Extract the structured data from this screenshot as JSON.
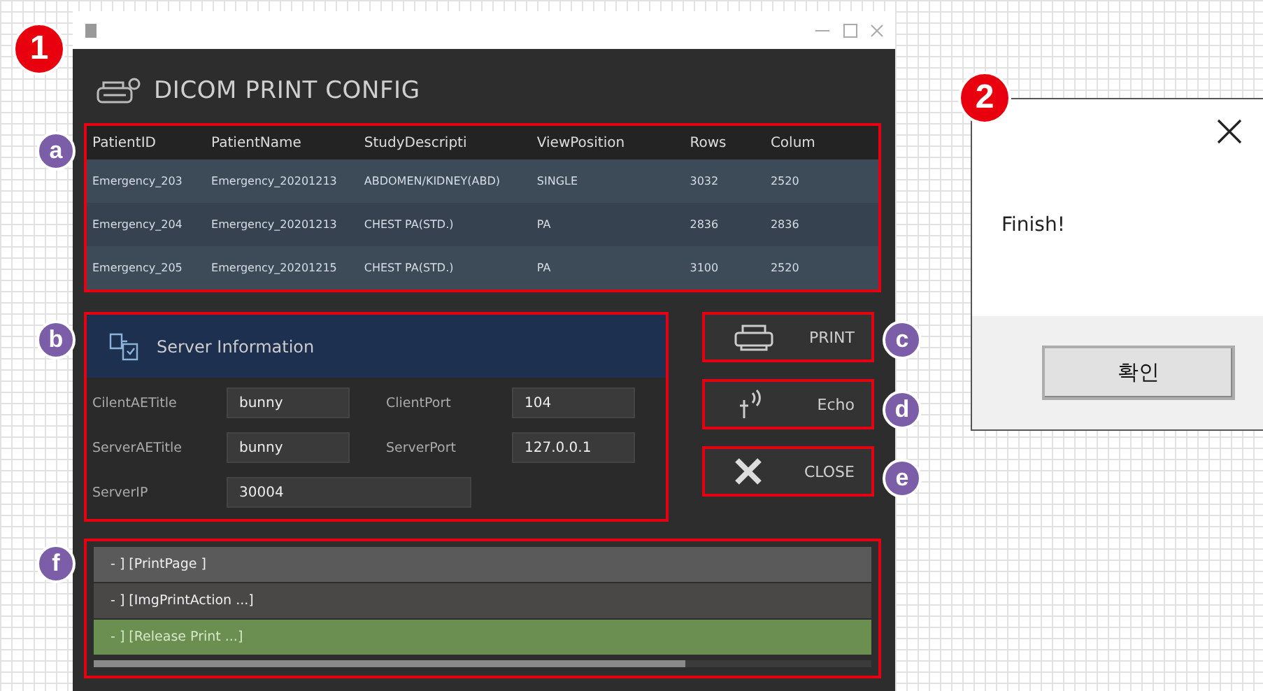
{
  "markers": [
    {
      "label": "1",
      "kind": "step"
    },
    {
      "label": "2",
      "kind": "step"
    },
    {
      "label": "a",
      "kind": "part"
    },
    {
      "label": "b",
      "kind": "part"
    },
    {
      "label": "c",
      "kind": "part"
    },
    {
      "label": "d",
      "kind": "part"
    },
    {
      "label": "e",
      "kind": "part"
    },
    {
      "label": "f",
      "kind": "part"
    }
  ],
  "config_window": {
    "heading": "DICOM PRINT CONFIG",
    "table": {
      "columns": [
        "PatientID",
        "PatientName",
        "StudyDescripti",
        "ViewPosition",
        "Rows",
        "Colum"
      ],
      "rows": [
        [
          "Emergency_203",
          "Emergency_20201213",
          "ABDOMEN/KIDNEY(ABD)",
          "SINGLE",
          "3032",
          "2520"
        ],
        [
          "Emergency_204",
          "Emergency_20201213",
          "CHEST PA(STD.)",
          "PA",
          "2836",
          "2836"
        ],
        [
          "Emergency_205",
          "Emergency_20201215",
          "CHEST PA(STD.)",
          "PA",
          "3100",
          "2520"
        ]
      ]
    },
    "server_info": {
      "title": "Server Information",
      "fields": [
        {
          "label": "CilentAETitle",
          "value": "bunny"
        },
        {
          "label": "ClientPort",
          "value": "104"
        },
        {
          "label": "ServerAETitle",
          "value": "bunny"
        },
        {
          "label": "ServerPort",
          "value": "127.0.0.1"
        },
        {
          "label": "ServerIP",
          "value": "30004"
        }
      ]
    },
    "buttons": [
      {
        "label": "PRINT",
        "kind": "print"
      },
      {
        "label": "Echo",
        "kind": "echo"
      },
      {
        "label": "CLOSE",
        "kind": "close"
      }
    ],
    "log": [
      {
        "text": "- ] [PrintPage ]",
        "selected": false
      },
      {
        "text": "- ] [ImgPrintAction ...]",
        "selected": false
      },
      {
        "text": "- ] [Release Print ...]",
        "selected": true
      }
    ]
  },
  "message_box": {
    "message": "Finish!",
    "button": "확인"
  }
}
